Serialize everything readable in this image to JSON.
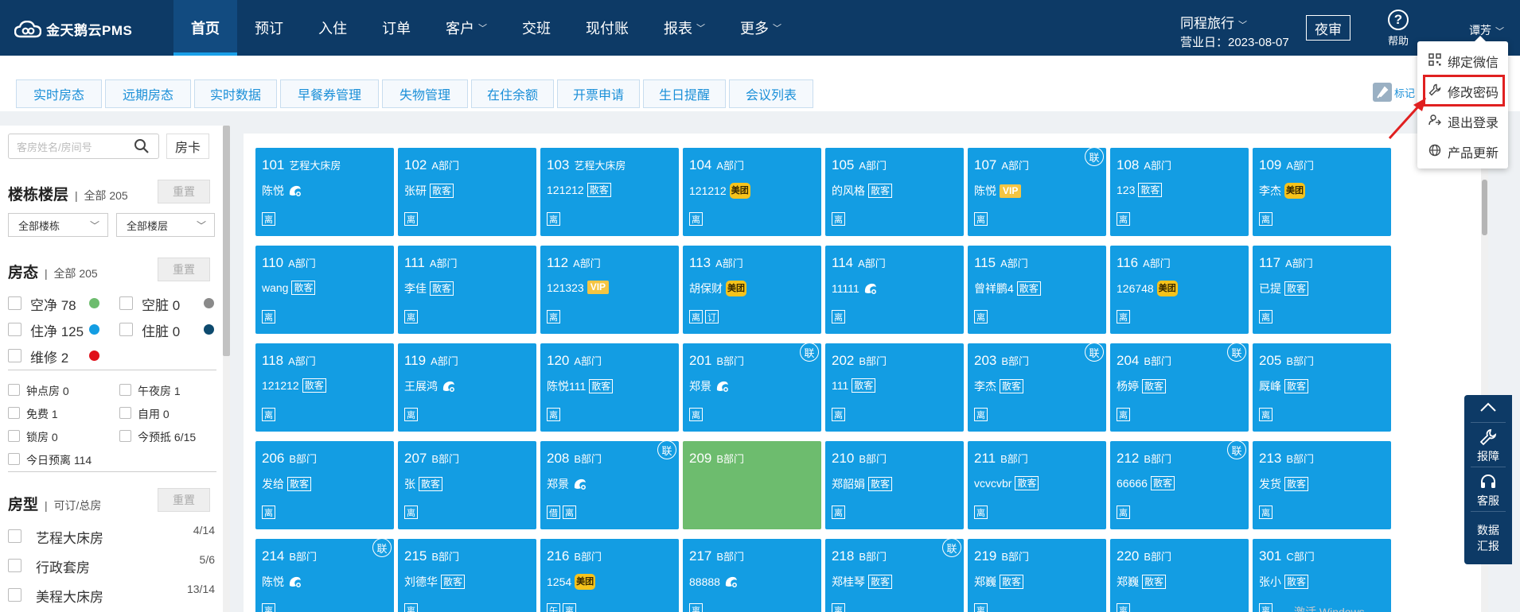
{
  "app": {
    "logo_text": "金天鹅云PMS"
  },
  "nav": {
    "items": [
      {
        "label": "首页",
        "active": true,
        "caret": false
      },
      {
        "label": "预订",
        "caret": false
      },
      {
        "label": "入住",
        "caret": false
      },
      {
        "label": "订单",
        "caret": false
      },
      {
        "label": "客户",
        "caret": true
      },
      {
        "label": "交班",
        "caret": false
      },
      {
        "label": "现付账",
        "caret": false
      },
      {
        "label": "报表",
        "caret": true
      },
      {
        "label": "更多",
        "caret": true
      }
    ],
    "caret_glyph": "﹀"
  },
  "header": {
    "hotel": "同程旅行",
    "business_date": "营业日：2023-08-07",
    "night_audit": "夜审",
    "help": "帮助",
    "user": "谭芳"
  },
  "user_menu": [
    {
      "label": "绑定微信",
      "icon": "qrcode-icon"
    },
    {
      "label": "修改密码",
      "icon": "wrench-icon",
      "highlighted": true
    },
    {
      "label": "退出登录",
      "icon": "logout-icon"
    },
    {
      "label": "产品更新",
      "icon": "globe-icon"
    }
  ],
  "subtabs": [
    "实时房态",
    "远期房态",
    "实时数据",
    "早餐券管理",
    "失物管理",
    "在住余额",
    "开票申请",
    "生日提醒",
    "会议列表"
  ],
  "mark_label": "标记",
  "sidebar": {
    "search_placeholder": "客房姓名/房间号",
    "room_card": "房卡",
    "reset": "重置",
    "building_floor": {
      "title": "楼栋楼层",
      "sub": "全部 205",
      "building_select": "全部楼栋",
      "floor_select": "全部楼层"
    },
    "room_state": {
      "title": "房态",
      "sub": "全部 205",
      "items": [
        {
          "label": "空净 78",
          "color": "#6dbc6e"
        },
        {
          "label": "空脏 0",
          "color": "#8a8a8a"
        },
        {
          "label": "住净 125",
          "color": "#139de3"
        },
        {
          "label": "住脏 0",
          "color": "#0d4a6e"
        },
        {
          "label": "维修 2",
          "color": "#e0101a"
        }
      ]
    },
    "filters": [
      "钟点房 0",
      "午夜房 1",
      "免费 1",
      "自用 0",
      "锁房 0",
      "今预抵 6/15",
      "今日预离 114"
    ],
    "room_type": {
      "title": "房型",
      "sub": "可订/总房",
      "items": [
        {
          "label": "艺程大床房",
          "count": "4/14"
        },
        {
          "label": "行政套房",
          "count": "5/6"
        },
        {
          "label": "美程大床房",
          "count": "13/14"
        }
      ]
    }
  },
  "rooms": [
    {
      "no": "101",
      "type": "艺程大床房",
      "guest": "陈悦",
      "tag": "ctrip",
      "bottom": [
        "离"
      ],
      "lian": false
    },
    {
      "no": "102",
      "type": "A部门",
      "guest": "张研",
      "tag": "散客",
      "bottom": [
        "离"
      ],
      "lian": false
    },
    {
      "no": "103",
      "type": "艺程大床房",
      "guest": "121212",
      "tag": "散客",
      "bottom": [
        "离"
      ],
      "lian": false
    },
    {
      "no": "104",
      "type": "A部门",
      "guest": "121212",
      "tag": "美团",
      "bottom": [
        "离"
      ],
      "lian": false
    },
    {
      "no": "105",
      "type": "A部门",
      "guest": "的风格",
      "tag": "散客",
      "bottom": [
        "离"
      ],
      "lian": false
    },
    {
      "no": "107",
      "type": "A部门",
      "guest": "陈悦",
      "tag": "VIP",
      "bottom": [
        "离"
      ],
      "lian": true
    },
    {
      "no": "108",
      "type": "A部门",
      "guest": "123",
      "tag": "散客",
      "bottom": [
        "离"
      ],
      "lian": false
    },
    {
      "no": "109",
      "type": "A部门",
      "guest": "李杰",
      "tag": "美团",
      "bottom": [
        "离"
      ],
      "lian": false
    },
    {
      "no": "110",
      "type": "A部门",
      "guest": "wang",
      "tag": "散客",
      "bottom": [
        "离"
      ],
      "lian": false
    },
    {
      "no": "111",
      "type": "A部门",
      "guest": "李佳",
      "tag": "散客",
      "bottom": [
        "离"
      ],
      "lian": false
    },
    {
      "no": "112",
      "type": "A部门",
      "guest": "121323",
      "tag": "VIP",
      "bottom": [
        "离"
      ],
      "lian": false
    },
    {
      "no": "113",
      "type": "A部门",
      "guest": "胡保财",
      "tag": "美团",
      "bottom": [
        "离",
        "订"
      ],
      "lian": false
    },
    {
      "no": "114",
      "type": "A部门",
      "guest": "11111",
      "tag": "ctrip",
      "bottom": [
        "离"
      ],
      "lian": false
    },
    {
      "no": "115",
      "type": "A部门",
      "guest": "曾祥鹏4",
      "tag": "散客",
      "bottom": [
        "离"
      ],
      "lian": false
    },
    {
      "no": "116",
      "type": "A部门",
      "guest": "126748",
      "tag": "美团",
      "bottom": [
        "离"
      ],
      "lian": false
    },
    {
      "no": "117",
      "type": "A部门",
      "guest": "已提",
      "tag": "散客",
      "bottom": [
        "离"
      ],
      "lian": false
    },
    {
      "no": "118",
      "type": "A部门",
      "guest": "121212",
      "tag": "散客",
      "bottom": [
        "离"
      ],
      "lian": false
    },
    {
      "no": "119",
      "type": "A部门",
      "guest": "王展鸿",
      "tag": "ctrip",
      "bottom": [
        "离"
      ],
      "lian": false
    },
    {
      "no": "120",
      "type": "A部门",
      "guest": "陈悦111",
      "tag": "散客",
      "bottom": [
        "离"
      ],
      "lian": false
    },
    {
      "no": "201",
      "type": "B部门",
      "guest": "郑景",
      "tag": "ctrip",
      "bottom": [
        "离"
      ],
      "lian": true
    },
    {
      "no": "202",
      "type": "B部门",
      "guest": "111",
      "tag": "散客",
      "bottom": [
        "离"
      ],
      "lian": false
    },
    {
      "no": "203",
      "type": "B部门",
      "guest": "李杰",
      "tag": "散客",
      "bottom": [
        "离"
      ],
      "lian": true
    },
    {
      "no": "204",
      "type": "B部门",
      "guest": "杨婷",
      "tag": "散客",
      "bottom": [
        "离"
      ],
      "lian": true
    },
    {
      "no": "205",
      "type": "B部门",
      "guest": "厩峰",
      "tag": "散客",
      "bottom": [
        "离"
      ],
      "lian": false
    },
    {
      "no": "206",
      "type": "B部门",
      "guest": "发给",
      "tag": "散客",
      "bottom": [
        "离"
      ],
      "lian": false
    },
    {
      "no": "207",
      "type": "B部门",
      "guest": "张",
      "tag": "散客",
      "bottom": [
        "离"
      ],
      "lian": false
    },
    {
      "no": "208",
      "type": "B部门",
      "guest": "郑景",
      "tag": "ctrip",
      "bottom": [
        "借",
        "离"
      ],
      "lian": true
    },
    {
      "no": "209",
      "type": "B部门",
      "guest": "",
      "tag": "",
      "bottom": [],
      "lian": false,
      "vacant": true
    },
    {
      "no": "210",
      "type": "B部门",
      "guest": "郑韶娟",
      "tag": "散客",
      "bottom": [
        "离"
      ],
      "lian": false
    },
    {
      "no": "211",
      "type": "B部门",
      "guest": "vcvcvbr",
      "tag": "散客",
      "bottom": [
        "离"
      ],
      "lian": false
    },
    {
      "no": "212",
      "type": "B部门",
      "guest": "66666",
      "tag": "散客",
      "bottom": [
        "离"
      ],
      "lian": true
    },
    {
      "no": "213",
      "type": "B部门",
      "guest": "发货",
      "tag": "散客",
      "bottom": [
        "离"
      ],
      "lian": false
    },
    {
      "no": "214",
      "type": "B部门",
      "guest": "陈悦",
      "tag": "ctrip",
      "bottom": [
        "离"
      ],
      "lian": true
    },
    {
      "no": "215",
      "type": "B部门",
      "guest": "刘德华",
      "tag": "散客",
      "bottom": [
        "离"
      ],
      "lian": false
    },
    {
      "no": "216",
      "type": "B部门",
      "guest": "1254",
      "tag": "美团",
      "bottom": [
        "午",
        "离"
      ],
      "lian": false
    },
    {
      "no": "217",
      "type": "B部门",
      "guest": "88888",
      "tag": "ctrip",
      "bottom": [
        "离"
      ],
      "lian": false
    },
    {
      "no": "218",
      "type": "B部门",
      "guest": "郑桂琴",
      "tag": "散客",
      "bottom": [
        "离"
      ],
      "lian": true
    },
    {
      "no": "219",
      "type": "B部门",
      "guest": "郑巍",
      "tag": "散客",
      "bottom": [
        "离"
      ],
      "lian": false
    },
    {
      "no": "220",
      "type": "B部门",
      "guest": "郑巍",
      "tag": "散客",
      "bottom": [
        "离"
      ],
      "lian": false
    },
    {
      "no": "301",
      "type": "C部门",
      "guest": "张小",
      "tag": "散客",
      "bottom": [
        "离"
      ],
      "lian": false
    }
  ],
  "lian_label": "联",
  "float_toolbar": {
    "report": "报障",
    "service": "客服",
    "data_report_1": "数据",
    "data_report_2": "汇报"
  },
  "watermark": "激活 Windows"
}
